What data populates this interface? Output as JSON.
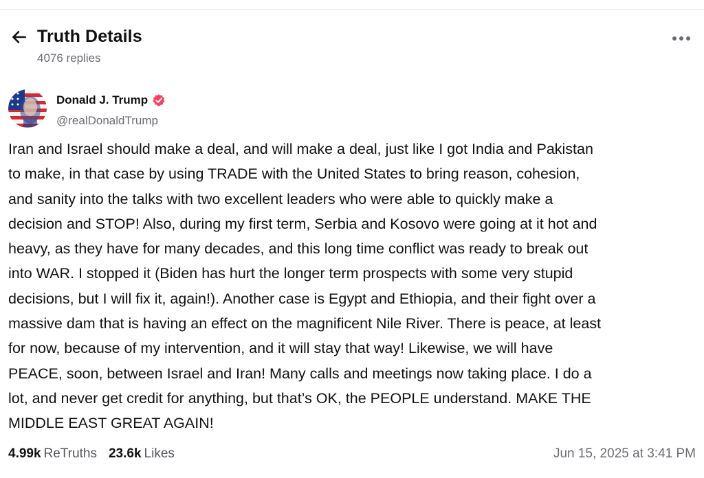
{
  "header": {
    "title": "Truth Details",
    "replies": "4076 replies",
    "back_icon": "arrow-left-icon",
    "more_icon": "ellipsis-icon"
  },
  "author": {
    "name": "Donald J. Trump",
    "handle": "@realDonaldTrump",
    "verified": true,
    "verified_color": "#f0455e"
  },
  "post": {
    "lines": [
      "Iran and Israel should make a deal, and will make a deal, just like I got India and Pakistan",
      "to make, in that case by using TRADE with the United States to bring reason, cohesion,",
      "and sanity into the talks with two excellent leaders who were able to quickly make a",
      "decision and STOP!  Also, during my first term, Serbia and Kosovo were going at it hot and",
      "heavy, as they have for many decades, and this long time conflict was ready to break out",
      "into WAR. I stopped it (Biden has hurt the longer term prospects with some very stupid",
      "decisions, but I will fix it, again!). Another case is Egypt and Ethiopia, and their fight over a",
      "massive dam that is having an effect on the magnificent Nile River. There is peace, at least",
      "for now, because of my intervention, and it will stay that way! Likewise, we will have",
      "PEACE, soon, between Israel and Iran! Many calls and meetings now taking place. I do a",
      "lot, and never get credit for anything, but that’s OK, the PEOPLE understand. MAKE THE",
      "MIDDLE EAST GREAT AGAIN!"
    ]
  },
  "stats": {
    "retruths_count": "4.99k",
    "retruths_label": "ReTruths",
    "likes_count": "23.6k",
    "likes_label": "Likes"
  },
  "timestamp": "Jun 15, 2025 at 3:41 PM"
}
